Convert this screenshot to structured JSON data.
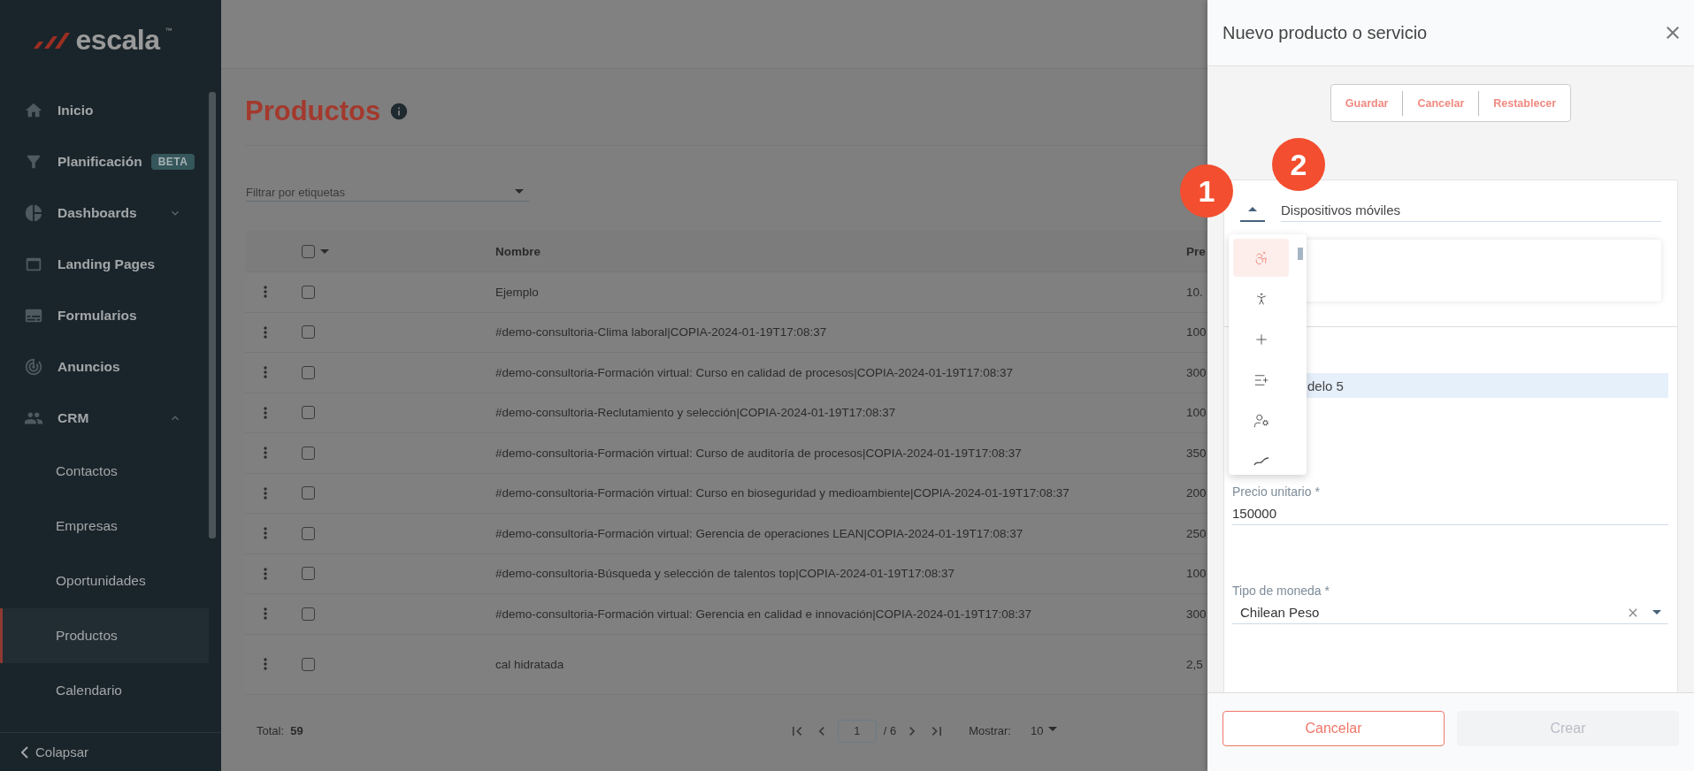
{
  "sidebar": {
    "logo": {
      "text": "escala",
      "mark": "™"
    },
    "items": [
      {
        "label": "Inicio",
        "selected": false
      },
      {
        "label": "Planificación",
        "badge": "BETA",
        "selected": false
      },
      {
        "label": "Dashboards",
        "expanded": false,
        "selected": false
      },
      {
        "label": "Landing Pages",
        "selected": false
      },
      {
        "label": "Formularios",
        "selected": false
      },
      {
        "label": "Anuncios",
        "selected": false
      },
      {
        "label": "CRM",
        "expanded": true,
        "selected": false,
        "children": [
          {
            "label": "Contactos",
            "selected": false
          },
          {
            "label": "Empresas",
            "selected": false
          },
          {
            "label": "Oportunidades",
            "selected": false
          },
          {
            "label": "Productos",
            "selected": true
          },
          {
            "label": "Calendario",
            "selected": false
          }
        ]
      }
    ],
    "collapse_label": "Colapsar"
  },
  "page": {
    "title": "Productos",
    "filter": {
      "placeholder": "Filtrar por etiquetas"
    },
    "table": {
      "columns": [
        "Nombre",
        "Pre"
      ],
      "select_all": {
        "checked": false
      },
      "rows": [
        {
          "name": "Ejemplo",
          "price": "10.",
          "checked": false
        },
        {
          "name": "#demo-consultoria-Clima laboral|COPIA-2024-01-19T17:08:37",
          "price": "100",
          "checked": false
        },
        {
          "name": "#demo-consultoria-Formación virtual: Curso en calidad de procesos|COPIA-2024-01-19T17:08:37",
          "price": "300",
          "checked": false
        },
        {
          "name": "#demo-consultoria-Reclutamiento y selección|COPIA-2024-01-19T17:08:37",
          "price": "100",
          "checked": false
        },
        {
          "name": "#demo-consultoria-Formación virtual: Curso de auditoría de procesos|COPIA-2024-01-19T17:08:37",
          "price": "350",
          "checked": false
        },
        {
          "name": "#demo-consultoria-Formación virtual: Curso en bioseguridad y medioambiente|COPIA-2024-01-19T17:08:37",
          "price": "200",
          "checked": false
        },
        {
          "name": "#demo-consultoria-Formación virtual: Gerencia de operaciones LEAN|COPIA-2024-01-19T17:08:37",
          "price": "250",
          "checked": false
        },
        {
          "name": "#demo-consultoria-Búsqueda y selección de talentos top|COPIA-2024-01-19T17:08:37",
          "price": "100",
          "checked": false
        },
        {
          "name": "#demo-consultoria-Formación virtual: Gerencia en calidad e innovación|COPIA-2024-01-19T17:08:37",
          "price": "300",
          "checked": false
        },
        {
          "name": "cal hidratada",
          "price": "2,5",
          "checked": false
        }
      ]
    },
    "footer": {
      "total_label": "Total:",
      "total": "59",
      "page": "1",
      "pages": "/ 6",
      "show_label": "Mostrar:",
      "page_size": "10"
    }
  },
  "drawer": {
    "title": "Nuevo producto o servicio",
    "toolbar": [
      "Guardar",
      "Cancelar",
      "Restablecer"
    ],
    "icon_select": {
      "expanded": true,
      "options": [
        {
          "selected": true
        },
        {
          "selected": false
        },
        {
          "selected": false
        },
        {
          "selected": false
        },
        {
          "selected": false
        },
        {
          "selected": false
        }
      ]
    },
    "name_field": {
      "value": "Dispositivos móviles"
    },
    "highlighted_row": "delo 5",
    "price": {
      "label": "Precio unitario *",
      "value": "150000"
    },
    "currency": {
      "label": "Tipo de moneda *",
      "value": "Chilean Peso"
    },
    "buttons": [
      {
        "label": "Cancelar",
        "disabled": false
      },
      {
        "label": "Crear",
        "disabled": true
      }
    ]
  },
  "annotations": [
    "1",
    "2"
  ]
}
